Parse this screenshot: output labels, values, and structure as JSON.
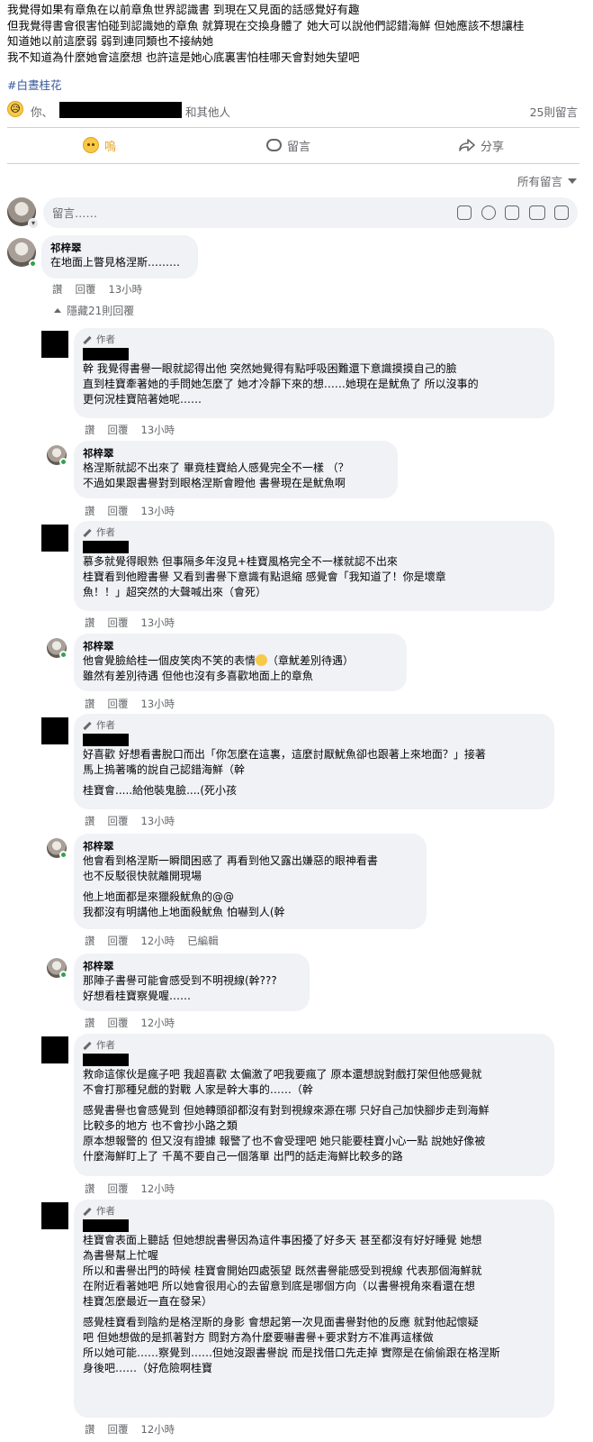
{
  "post": {
    "lines": [
      "我覺得如果有章魚在以前章魚世界認識書 到現在又見面的話感覺好有趣",
      "但我覺得書會很害怕碰到認識她的章魚 就算現在交換身體了 她大可以說他們認錯海鮮 但她應該不想讓桂",
      "知道她以前這麼弱 弱到連同類也不接納她",
      "我不知道為什麼她會這麼想 也許這是她心底裏害怕桂哪天會對她失望吧"
    ],
    "hashtag": "#白晝桂花"
  },
  "reactions": {
    "emoji": "😥",
    "you": "你、",
    "others": "和其他人",
    "comment_count": "25則留言"
  },
  "actions": {
    "react": "嗚",
    "comment": "留言",
    "share": "分享"
  },
  "sort_label": "所有留言",
  "composer": {
    "placeholder": "留言……"
  },
  "labels": {
    "like": "讚",
    "reply": "回覆",
    "author_badge": "作者",
    "edited": "已編輯",
    "hide_replies": "隱藏21則回覆"
  },
  "comments": [
    {
      "name": "祁梓翠",
      "lines": [
        "在地面上瞥見格涅斯………"
      ],
      "time": "13小時"
    },
    {
      "author": true,
      "lines": [
        "幹 我覺得書譽一眼就認得出他 突然她覺得有點呼吸困難還下意識摸摸自己的臉",
        "直到桂寶牽著她的手問她怎麼了 她才冷靜下來的想……她現在是魷魚了 所以沒事的",
        "更何況桂寶陪著她呢……"
      ],
      "time": "13小時"
    },
    {
      "name": "祁梓翠",
      "lines": [
        "格涅斯就認不出來了 畢竟桂寶給人感覺完全不一樣 （？",
        "不過如果跟書譽對到眼格涅斯會瞪他 書譽現在是魷魚啊"
      ],
      "time": "13小時"
    },
    {
      "author": true,
      "lines": [
        "慕多就覺得眼熟 但事隔多年沒見+桂寶風格完全不一樣就認不出來",
        "桂寶看到他瞪書譽 又看到書譽下意識有點退縮 感覺會「我知道了！你是壞章",
        "魚！！」超突然的大聲喊出來（會死）"
      ],
      "time": "13小時"
    },
    {
      "name": "祁梓翠",
      "lines": [
        "他會覺臉給桂一個皮笑肉不笑的表情",
        "雖然有差別待遇 但他也沒有多喜歡地面上的章魚"
      ],
      "line1_suffix": "（章魷差別待遇）",
      "time": "13小時"
    },
    {
      "author": true,
      "lines": [
        "好喜歡 好想看書脫口而出「你怎麼在這裏，這麼討厭魷魚卻也跟著上來地面？」接著",
        "馬上摀著嘴的說自己認錯海鮮（幹",
        "桂寶會.....給他裝鬼臉....(死小孩"
      ],
      "time": "13小時"
    },
    {
      "name": "祁梓翠",
      "lines": [
        "他會看到格涅斯一瞬間困惑了 再看到他又露出嫌惡的眼神看書",
        "也不反駁很快就離開現場",
        "他上地面都是來獵殺魷魚的@@",
        "我都沒有明講他上地面殺魷魚 怕嚇到人(幹"
      ],
      "time": "12小時"
    },
    {
      "name": "祁梓翠",
      "lines": [
        "那陣子書譽可能會感受到不明視線(幹???",
        "好想看桂寶察覺喔……"
      ],
      "time": "12小時"
    },
    {
      "author": true,
      "lines": [
        "救命這傢伙是瘋子吧 我超喜歡 太偏激了吧我要瘋了 原本還想說對戲打架但他感覺就",
        "不會打那種兒戲的對戰 人家是幹大事的……（幹",
        "感覺書譽也會感覺到 但她轉頭卻都沒有對到視線來源在哪 只好自己加快腳步走到海鮮",
        "比較多的地方 也不會抄小路之類",
        "原本想報警的 但又沒有證據 報警了也不會受理吧 她只能要桂寶小心一點 說她好像被",
        "什麼海鮮盯上了 千萬不要自己一個落單 出門的話走海鮮比較多的路"
      ],
      "time": "12小時"
    },
    {
      "author": true,
      "lines": [
        "桂寶會表面上聽話 但她想說書譽因為這件事困擾了好多天 甚至都沒有好好睡覺 她想",
        "為書譽幫上忙喔",
        "所以和書譽出門的時候 桂寶會開始四處張望 既然書譽能感受到視線 代表那個海鮮就",
        "在附近看著她吧 所以她會很用心的去留意到底是哪個方向（以書譽視角來看還在想",
        "桂寶怎麼最近一直在發呆）",
        "感覺桂寶看到陰約是格涅斯的身影 會想起第一次見面書譽對他的反應 就對他起懷疑",
        "吧 但她想做的是抓著對方 問對方為什麼要嚇書譽+要求對方不准再這樣做",
        "所以她可能……察覺到……但她沒跟書譽說 而是找借口先走掉 實際是在偷偷跟在格涅斯",
        "身後吧……（好危險啊桂寶"
      ],
      "time": "12小時"
    }
  ]
}
